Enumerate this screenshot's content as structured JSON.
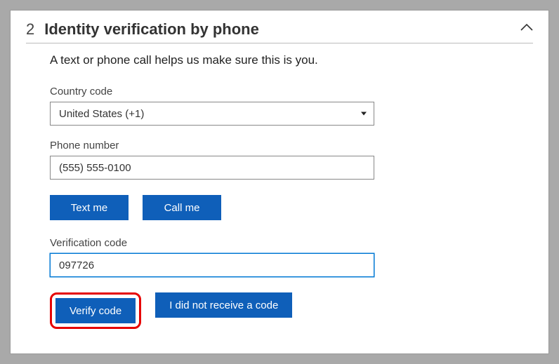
{
  "step_number": "2",
  "section_title": "Identity verification by phone",
  "description": "A text or phone call helps us make sure this is you.",
  "country": {
    "label": "Country code",
    "selected": "United States (+1)"
  },
  "phone": {
    "label": "Phone number",
    "value": "(555) 555-0100"
  },
  "buttons": {
    "text_me": "Text me",
    "call_me": "Call me",
    "verify": "Verify code",
    "no_code": "I did not receive a code"
  },
  "verification": {
    "label": "Verification code",
    "value": "097726"
  },
  "colors": {
    "primary": "#0f5fb9",
    "highlight": "#e60000"
  }
}
